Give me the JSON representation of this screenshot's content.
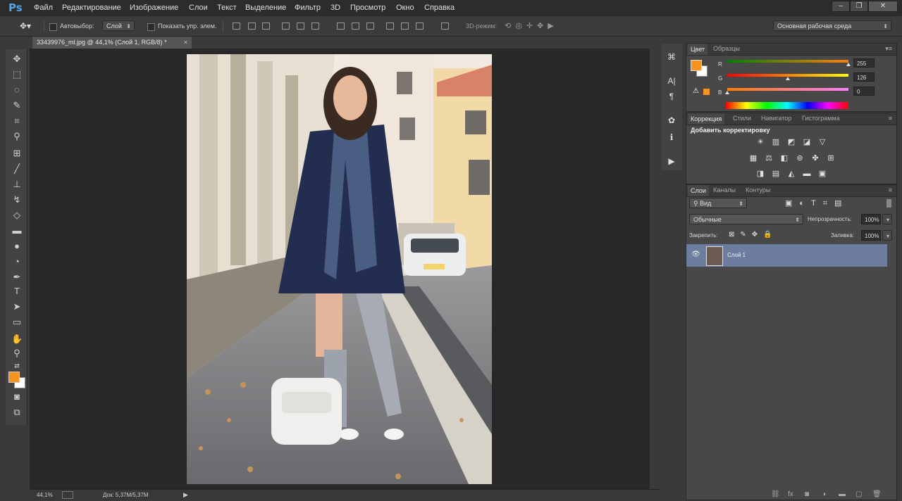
{
  "menubar": {
    "logo": "Ps",
    "items": [
      "Файл",
      "Редактирование",
      "Изображение",
      "Слои",
      "Текст",
      "Выделение",
      "Фильтр",
      "3D",
      "Просмотр",
      "Окно",
      "Справка"
    ],
    "window_buttons": [
      "–",
      "❐",
      "✕"
    ]
  },
  "options": {
    "autoselect_label": "Автовыбор:",
    "autoselect_value": "Слой",
    "show_controls_label": "Показать упр. элем.",
    "mode3d_label": "3D-режим:",
    "workspace": "Основная рабочая среда"
  },
  "document": {
    "tab_title": "33439976_ml.jpg @ 44,1% (Слой 1, RGB/8) *",
    "tab_close": "×",
    "zoom": "44,1%",
    "doc_size": "Док: 5,37M/5,37M"
  },
  "color_panel": {
    "tabs": [
      "Цвет",
      "Образцы"
    ],
    "channels": [
      {
        "label": "R",
        "value": "255",
        "level": 1.0
      },
      {
        "label": "G",
        "value": "126",
        "level": 0.49
      },
      {
        "label": "B",
        "value": "0",
        "level": 0.0
      }
    ],
    "foreground": "#f7931e",
    "background": "#ffffff"
  },
  "adjustments_panel": {
    "tabs": [
      "Коррекция",
      "Стили",
      "Навигатор",
      "Гистограмма"
    ],
    "heading": "Добавить корректировку",
    "icons": [
      "brightness-icon",
      "levels-icon",
      "curves-icon",
      "exposure-icon",
      "vibrance-icon",
      "hue-saturation-icon",
      "color-balance-icon",
      "black-white-icon",
      "photo-filter-icon",
      "channel-mixer-icon",
      "color-lookup-icon",
      "invert-icon",
      "posterize-icon",
      "threshold-icon",
      "gradient-map-icon",
      "selective-color-icon"
    ]
  },
  "layers_panel": {
    "tabs": [
      "Слои",
      "Каналы",
      "Контуры"
    ],
    "kind_filter": "Вид",
    "blend_mode": "Обычные",
    "opacity_label": "Непрозрачность:",
    "opacity_value": "100%",
    "lock_label": "Закрепить:",
    "fill_label": "Заливка:",
    "fill_value": "100%",
    "layers": [
      {
        "name": "Слой 1",
        "visible": true
      }
    ]
  }
}
